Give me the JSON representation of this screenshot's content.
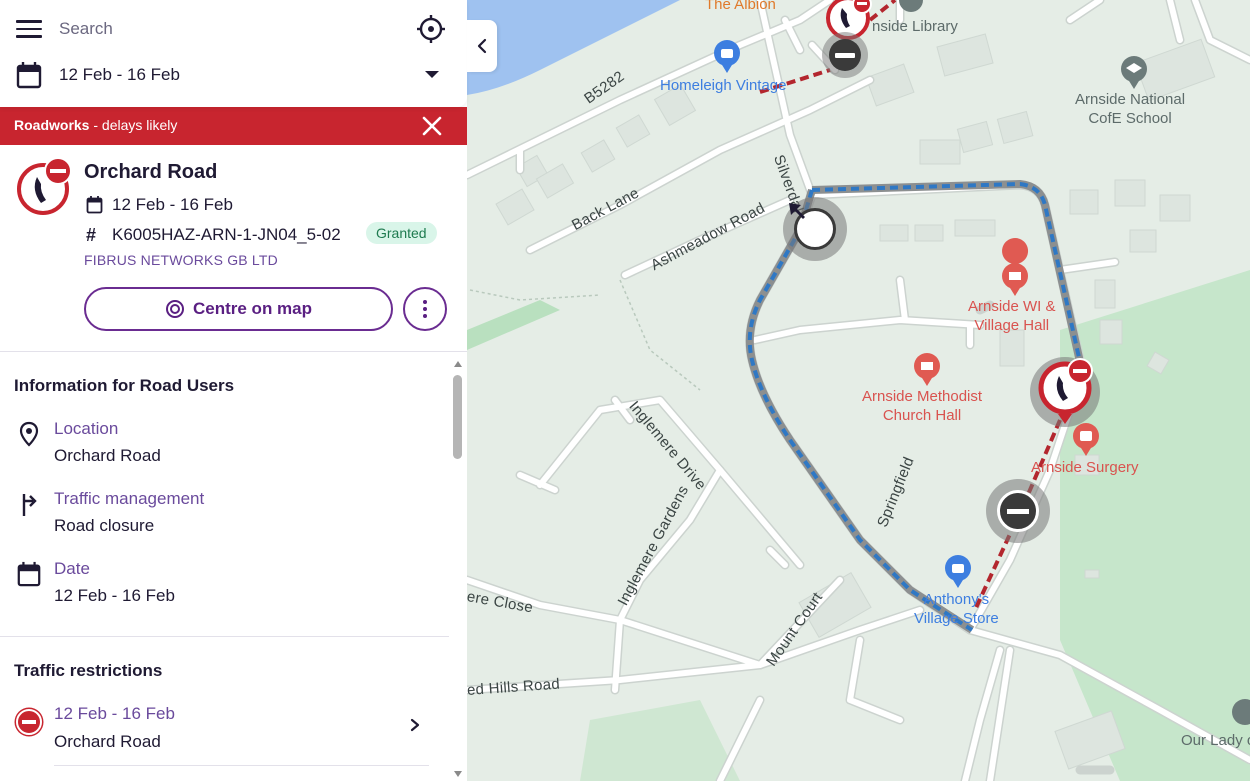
{
  "search": {
    "placeholder": "Search"
  },
  "date_filter": {
    "value": "12 Feb - 16 Feb"
  },
  "alert": {
    "title": "Roadworks",
    "subtitle": "- delays likely"
  },
  "works": {
    "title": "Orchard Road",
    "date": "12 Feb - 16 Feb",
    "hash_symbol": "#",
    "reference": "K6005HAZ-ARN-1-JN04_5-02",
    "status": "Granted",
    "organisation": "FIBRUS NETWORKS GB LTD",
    "centre_button": "Centre on map"
  },
  "info": {
    "heading": "Information for Road Users",
    "location_label": "Location",
    "location_value": "Orchard Road",
    "traffic_label": "Traffic management",
    "traffic_value": "Road closure",
    "date_label": "Date",
    "date_value": "12 Feb - 16 Feb"
  },
  "restrictions": {
    "heading": "Traffic restrictions",
    "items": [
      {
        "date": "12 Feb - 16 Feb",
        "road": "Orchard Road"
      }
    ]
  },
  "map": {
    "roads": {
      "b5282": "B5282",
      "back_lane": "Back Lane",
      "ashmeadow": "Ashmeadow Road",
      "silverdale": "Silverdal",
      "inglemere_drive": "Inglemere Drive",
      "inglemere_gardens": "Inglemere Gardens",
      "springfield": "Springfield",
      "mount_court": "Mount Court",
      "close": "ere Close",
      "red_hills": "ed Hills Road"
    },
    "pois": {
      "albion": "The Albion",
      "library": "nside Library",
      "homeleigh": "Homeleigh Vintage",
      "school_line1": "Arnside National",
      "school_line2": "CofE School",
      "wi_line1": "Arnside WI &",
      "wi_line2": "Village Hall",
      "methodist_line1": "Arnside Methodist",
      "methodist_line2": "Church Hall",
      "surgery": "Arnside Surgery",
      "store_line1": "Anthony's",
      "store_line2": "Village Store",
      "lady": "Our Lady o"
    },
    "colors": {
      "closure_route": "#2f78c4",
      "works_line": "#b3262e",
      "water": "#9fc2f0",
      "park": "#c6e6cb"
    }
  },
  "colors": {
    "accent": "#6a2c91",
    "alert": "#c8252f",
    "badge_bg": "#d9f5e9",
    "badge_text": "#1e7a4f"
  }
}
